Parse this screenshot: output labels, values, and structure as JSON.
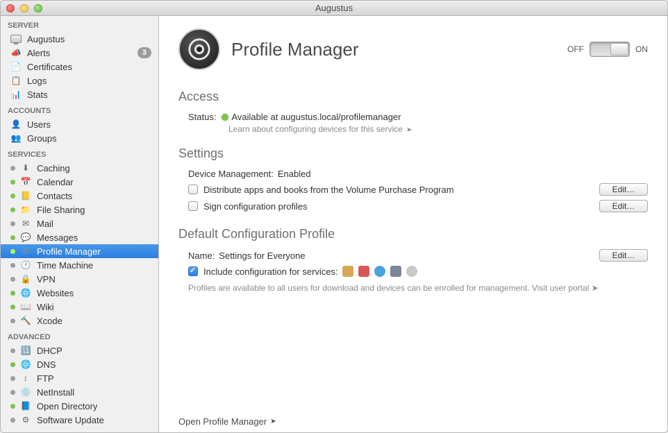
{
  "window": {
    "title": "Augustus"
  },
  "sidebar": {
    "sections": [
      {
        "title": "SERVER",
        "items": [
          {
            "label": "Augustus"
          },
          {
            "label": "Alerts",
            "badge": "3"
          },
          {
            "label": "Certificates"
          },
          {
            "label": "Logs"
          },
          {
            "label": "Stats"
          }
        ]
      },
      {
        "title": "ACCOUNTS",
        "items": [
          {
            "label": "Users"
          },
          {
            "label": "Groups"
          }
        ]
      },
      {
        "title": "SERVICES",
        "items": [
          {
            "label": "Caching"
          },
          {
            "label": "Calendar"
          },
          {
            "label": "Contacts"
          },
          {
            "label": "File Sharing"
          },
          {
            "label": "Mail"
          },
          {
            "label": "Messages"
          },
          {
            "label": "Profile Manager",
            "selected": true
          },
          {
            "label": "Time Machine"
          },
          {
            "label": "VPN"
          },
          {
            "label": "Websites"
          },
          {
            "label": "Wiki"
          },
          {
            "label": "Xcode"
          }
        ]
      },
      {
        "title": "ADVANCED",
        "items": [
          {
            "label": "DHCP"
          },
          {
            "label": "DNS"
          },
          {
            "label": "FTP"
          },
          {
            "label": "NetInstall"
          },
          {
            "label": "Open Directory"
          },
          {
            "label": "Software Update"
          }
        ]
      }
    ]
  },
  "content": {
    "title": "Profile Manager",
    "toggle": {
      "off": "OFF",
      "on": "ON",
      "state": "on"
    },
    "access": {
      "heading": "Access",
      "status_label": "Status:",
      "status_text": "Available at augustus.local/profilemanager",
      "learn": "Learn about configuring devices for this service"
    },
    "settings": {
      "heading": "Settings",
      "device_label": "Device Management:",
      "device_value": "Enabled",
      "distribute": "Distribute apps and books from the Volume Purchase Program",
      "sign": "Sign configuration profiles",
      "edit": "Edit…"
    },
    "profile": {
      "heading": "Default Configuration Profile",
      "name_label": "Name:",
      "name_value": "Settings for Everyone",
      "include": "Include configuration for services:",
      "edit": "Edit…",
      "hint": "Profiles are available to all users for download and devices can be enrolled for management. Visit user portal"
    },
    "open_link": "Open Profile Manager"
  }
}
